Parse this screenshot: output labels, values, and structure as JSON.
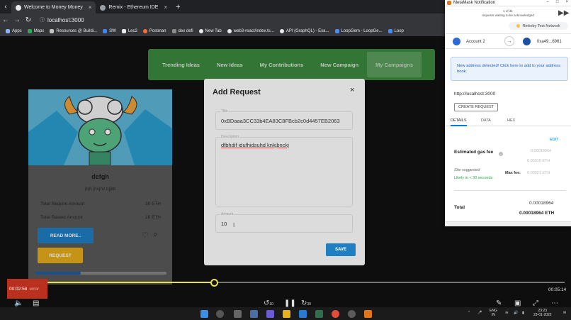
{
  "browser": {
    "tabs": [
      {
        "label": "Welcome to Money Money",
        "active": true
      },
      {
        "label": "Remix - Ethereum IDE",
        "active": false
      }
    ],
    "url": "localhost:3000",
    "bookmarks": [
      "Apps",
      "Maps",
      "Resources @ Buildi...",
      "SW",
      "Lec2",
      "Postman",
      "dex defi",
      "New Tab",
      "web3-react/index.ts...",
      "API (GraphQL) - Exa...",
      "LoopGem - LoopGe...",
      "Loop"
    ]
  },
  "nav": {
    "items": [
      "Trending Ideas",
      "New Ideas",
      "My Contributions",
      "New Campaign",
      "My Campaigns"
    ]
  },
  "card": {
    "title": "defgh",
    "description": "jbjh jhvjhv bjjkb",
    "require_label": "Total Require Amount",
    "require_value": "30 ETH",
    "raised_label": "Total Rasied Amount",
    "raised_value": "10 ETH",
    "read_more": "READ MORE..",
    "likes": "0",
    "request": "REQUEST",
    "progress": 0.35
  },
  "modal": {
    "title": "Add Request",
    "close": "×",
    "title_label": "Title",
    "title_value": "0xBDaaa3CC33b4EA83C8FBcb2c0d4457EB2063",
    "description_label": "Description",
    "description_value": "dfbhdif idufhidsuhd knkjbnckj",
    "amount_label": "Amount",
    "amount_value": "10",
    "save": "SAVE"
  },
  "video": {
    "current_time": "00:02:58",
    "overlay_text": "error",
    "total_time": "00:05:14",
    "progress": 0.37,
    "skip_back": "10",
    "skip_forward": "30"
  },
  "taskbar": {
    "lang_top": "ENG",
    "lang_bottom": "IN",
    "time": "23:23",
    "date": "23-01-2022"
  },
  "metamask": {
    "window_title": "MetaMask Notification",
    "counter_line1": "1 of 31",
    "counter_line2": "requests waiting to be acknowledged",
    "network": "Rinkeby Test Network",
    "account_name": "Account 2",
    "to_address": "0xa49...6961",
    "notice": "New address detected! Click here to add to your address book.",
    "origin": "http://localhost:3000",
    "tx_type": "CREATE REQUEST",
    "tabs": [
      "DETAILS",
      "DATA",
      "HEX"
    ],
    "edit": "EDIT",
    "gas_label": "Estimated gas fee",
    "gas_faint_1": "0.00018964",
    "gas_faint_2": "0.00018 ETH",
    "gas_faint_3": "0.00021 ETH",
    "site_suggested": "Site suggested",
    "likely": "Likely in < 30 seconds",
    "max_fee": "Max fee:",
    "total_label": "Total",
    "total_value": "0.00018964",
    "total_eth": "0.00018964 ETH",
    "colors": {
      "accent": "#037dd6",
      "network_dot": "#f6c343"
    }
  }
}
